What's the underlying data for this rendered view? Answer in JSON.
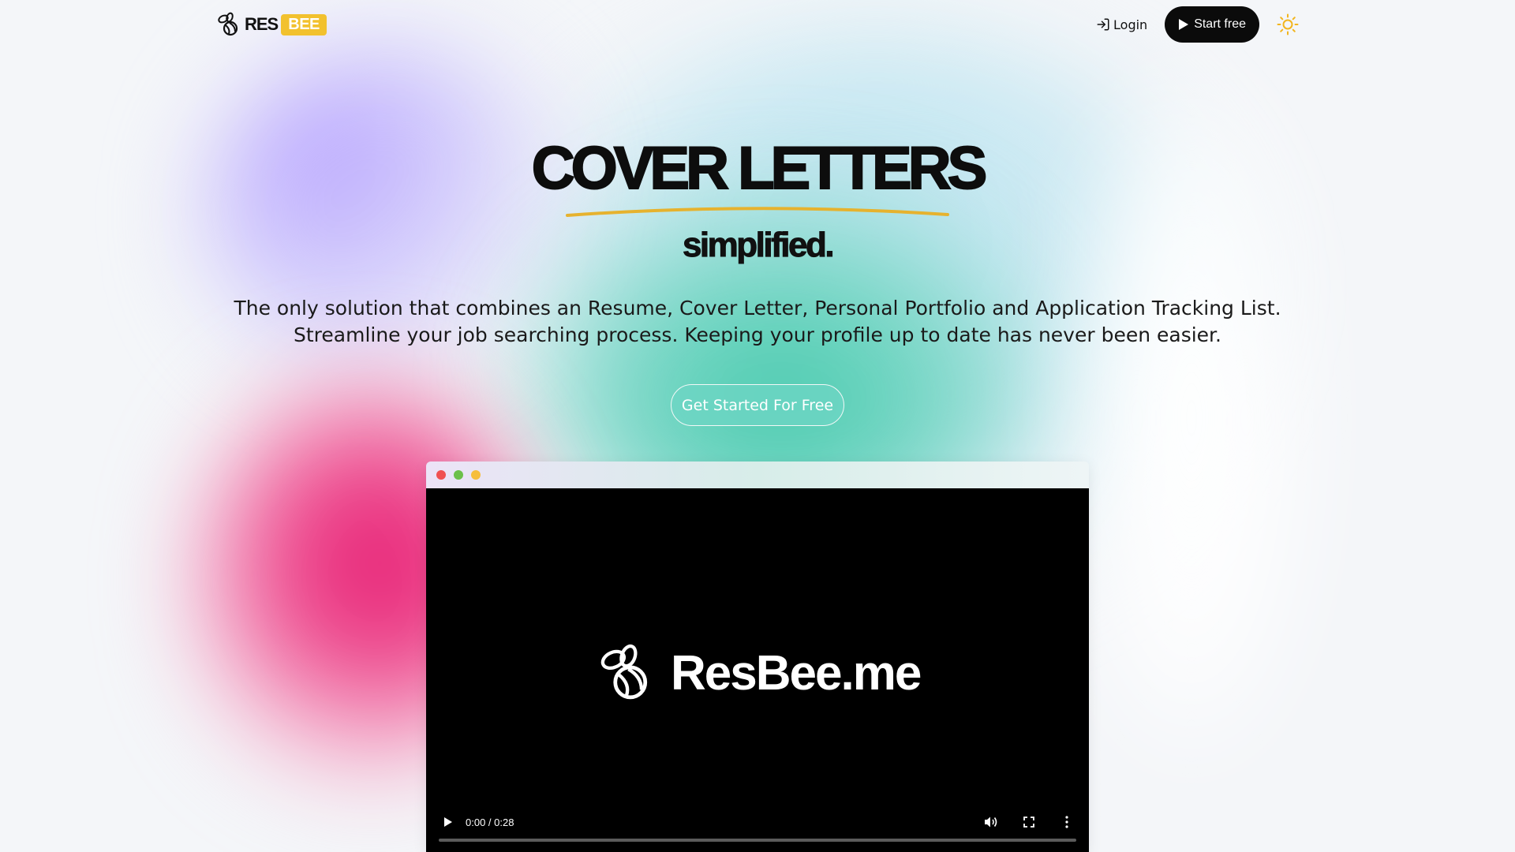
{
  "brand": {
    "logo_res": "RES",
    "logo_bee": "BEE",
    "accent_color": "#f2c12e"
  },
  "nav": {
    "login_label": "Login",
    "start_label": "Start free",
    "theme_icon": "sun-icon"
  },
  "hero": {
    "title": "COVER LETTERS",
    "subtitle": "simplified.",
    "tagline_line1": "The only solution that combines an Resume, Cover Letter, Personal Portfolio and Application Tracking List.",
    "tagline_line2": "Streamline your job searching process. Keeping your profile up to date has never been easier.",
    "cta_label": "Get Started For Free"
  },
  "video": {
    "logo_text": "ResBee.me",
    "time_display": "0:00 / 0:28",
    "progress": 0,
    "window_dots": [
      "#f05151",
      "#6cc04a",
      "#f6be3c"
    ]
  }
}
